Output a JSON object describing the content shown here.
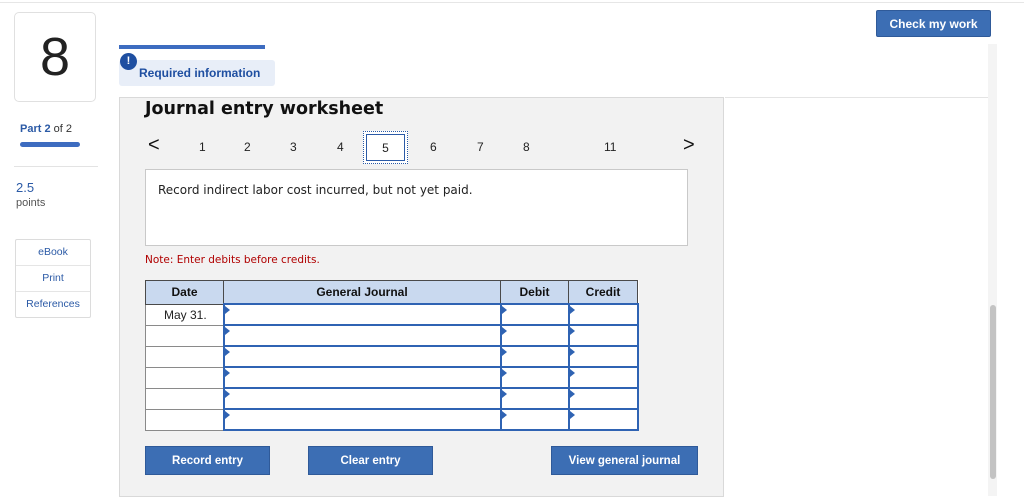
{
  "sidebar": {
    "question_number": "8",
    "part_prefix": "Part",
    "part_current": "2",
    "part_of": "of 2",
    "points_value": "2.5",
    "points_label": "points",
    "links": [
      "eBook",
      "Print",
      "References"
    ]
  },
  "header": {
    "check_button": "Check my work",
    "required_icon": "!",
    "required_label": "Required information"
  },
  "worksheet": {
    "title": "Journal entry worksheet",
    "nav_prev": "<",
    "nav_next": ">",
    "steps": [
      "1",
      "2",
      "3",
      "4",
      "5",
      "6",
      "7",
      "8",
      "11"
    ],
    "active_step": "5",
    "description": "Record indirect labor cost incurred, but not yet paid.",
    "note": "Note: Enter debits before credits.",
    "table": {
      "headers": [
        "Date",
        "General Journal",
        "Debit",
        "Credit"
      ],
      "rows": [
        {
          "date": "May 31.",
          "account": "",
          "debit": "",
          "credit": ""
        },
        {
          "date": "",
          "account": "",
          "debit": "",
          "credit": ""
        },
        {
          "date": "",
          "account": "",
          "debit": "",
          "credit": ""
        },
        {
          "date": "",
          "account": "",
          "debit": "",
          "credit": ""
        },
        {
          "date": "",
          "account": "",
          "debit": "",
          "credit": ""
        },
        {
          "date": "",
          "account": "",
          "debit": "",
          "credit": ""
        }
      ]
    },
    "buttons": {
      "record": "Record entry",
      "clear": "Clear entry",
      "view": "View general journal"
    }
  },
  "colors": {
    "accent": "#3c6eb4",
    "header_fill": "#c9d9ef",
    "note_red": "#b00000"
  }
}
